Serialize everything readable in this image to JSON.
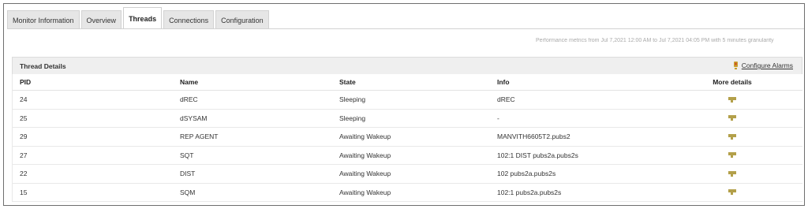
{
  "tabs": [
    {
      "label": "Monitor Information",
      "active": false
    },
    {
      "label": "Overview",
      "active": false
    },
    {
      "label": "Threads",
      "active": true
    },
    {
      "label": "Connections",
      "active": false
    },
    {
      "label": "Configuration",
      "active": false
    }
  ],
  "metrics_text": "Performance metrics from Jul 7,2021 12:00 AM to Jul 7,2021 04:05 PM with 5 minutes granularity",
  "panel": {
    "title": "Thread Details",
    "configure_alarms": "Configure Alarms",
    "alarm_icon": "bell-icon"
  },
  "table": {
    "columns": [
      "PID",
      "Name",
      "State",
      "Info",
      "More details"
    ],
    "rows": [
      {
        "pid": "24",
        "name": "dREC",
        "state": "Sleeping",
        "info": "dREC"
      },
      {
        "pid": "25",
        "name": "dSYSAM",
        "state": "Sleeping",
        "info": "-"
      },
      {
        "pid": "29",
        "name": "REP AGENT",
        "state": "Awaiting Wakeup",
        "info": "MANVITH6605T2.pubs2"
      },
      {
        "pid": "27",
        "name": "SQT",
        "state": "Awaiting Wakeup",
        "info": "102:1 DIST pubs2a.pubs2s"
      },
      {
        "pid": "22",
        "name": "DIST",
        "state": "Awaiting Wakeup",
        "info": "102 pubs2a.pubs2s"
      },
      {
        "pid": "15",
        "name": "SQM",
        "state": "Awaiting Wakeup",
        "info": "102:1 pubs2a.pubs2s"
      }
    ],
    "detail_icon": "details-icon"
  },
  "colors": {
    "detail_icon": "#b3a04a",
    "bell": "#c8a030",
    "bell_accent": "#d04020"
  }
}
